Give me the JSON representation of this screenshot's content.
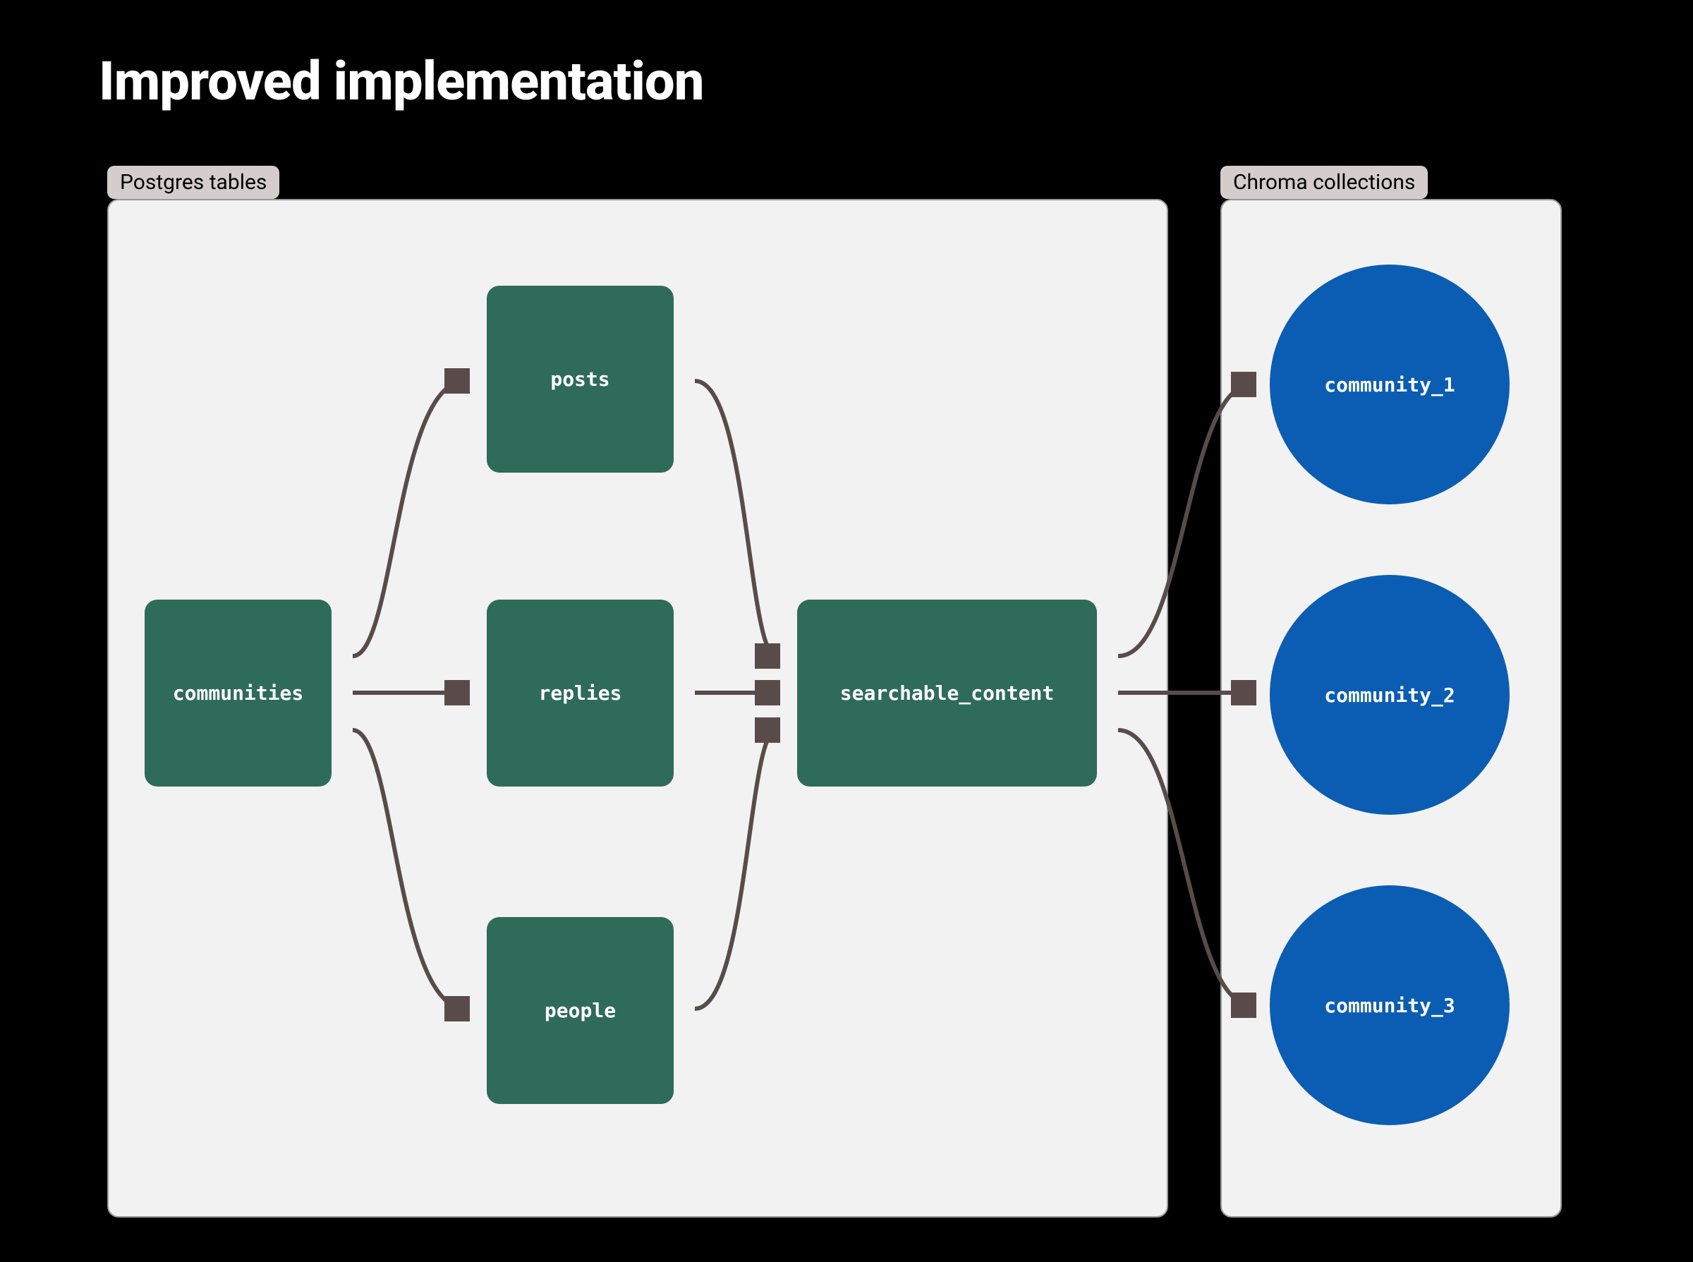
{
  "title": "Improved implementation",
  "panels": {
    "postgres": {
      "label": "Postgres tables"
    },
    "chroma": {
      "label": "Chroma collections"
    }
  },
  "tables": {
    "communities": "communities",
    "posts": "posts",
    "replies": "replies",
    "people": "people",
    "searchable_content": "searchable_content"
  },
  "collections": {
    "c1": "community_1",
    "c2": "community_2",
    "c3": "community_3"
  },
  "edges": [
    {
      "from": "communities",
      "to": "posts"
    },
    {
      "from": "communities",
      "to": "replies"
    },
    {
      "from": "communities",
      "to": "people"
    },
    {
      "from": "posts",
      "to": "searchable_content"
    },
    {
      "from": "replies",
      "to": "searchable_content"
    },
    {
      "from": "people",
      "to": "searchable_content"
    },
    {
      "from": "searchable_content",
      "to": "community_1"
    },
    {
      "from": "searchable_content",
      "to": "community_2"
    },
    {
      "from": "searchable_content",
      "to": "community_3"
    }
  ],
  "colors": {
    "table_fill": "#2f6b59",
    "collection_fill": "#0b5db3",
    "panel_fill": "#f2f2f2",
    "label_fill": "#d4cdcc",
    "arrow_stroke": "#5a4b4b",
    "text_on_shape": "#ffffff"
  }
}
